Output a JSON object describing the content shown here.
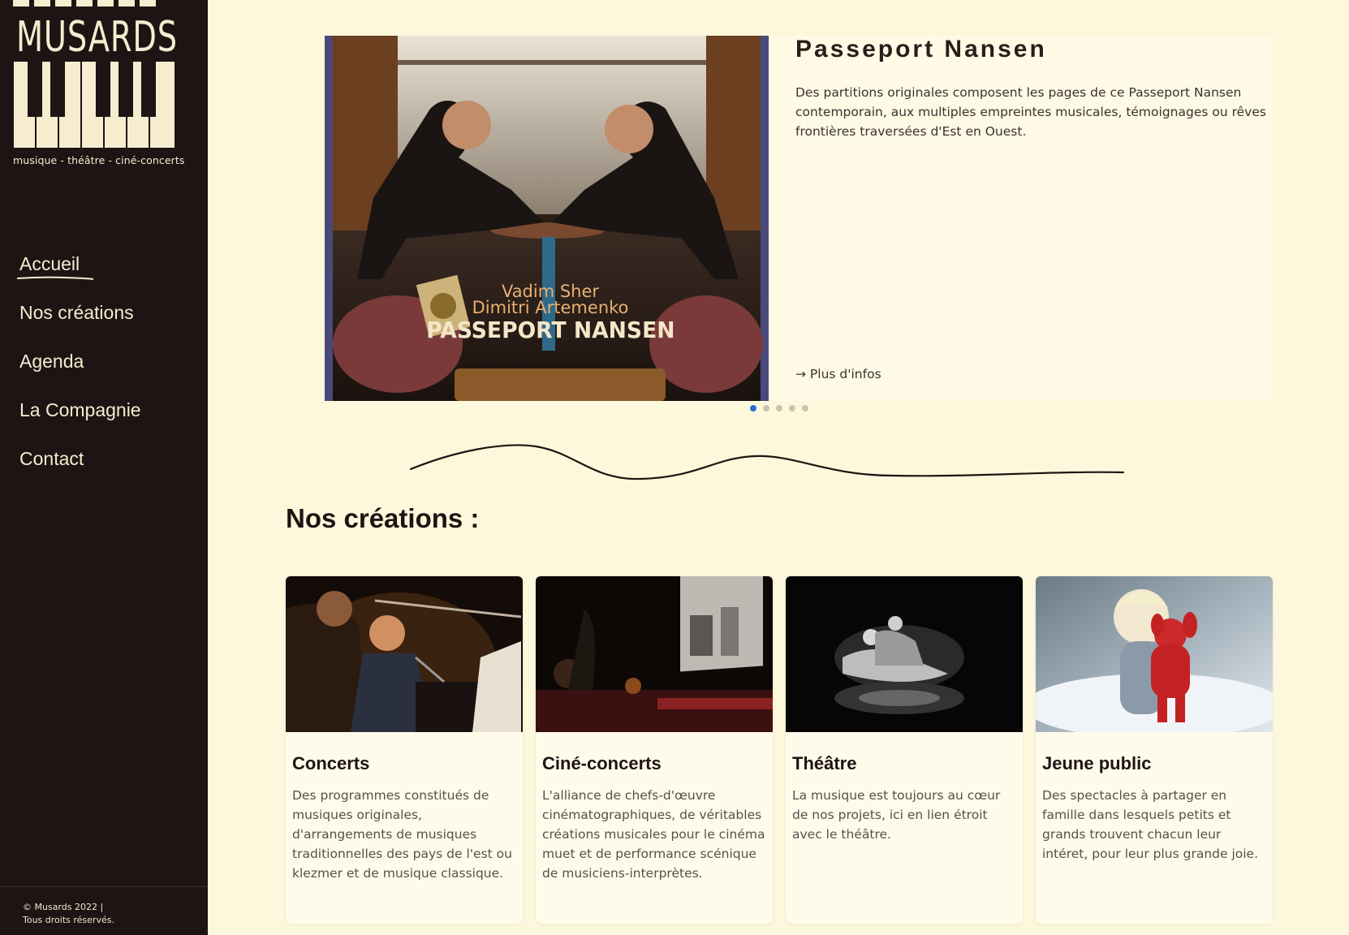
{
  "brand": {
    "name": "MUSARDS",
    "tagline": "musique - théâtre - ciné-concerts"
  },
  "nav": {
    "items": [
      {
        "label": "Accueil",
        "active": true
      },
      {
        "label": "Nos créations",
        "active": false
      },
      {
        "label": "Agenda",
        "active": false
      },
      {
        "label": "La Compagnie",
        "active": false
      },
      {
        "label": "Contact",
        "active": false
      }
    ]
  },
  "footer": {
    "copyright": "© Musards 2022 |",
    "rights": "Tous droits réservés."
  },
  "slider": {
    "title": "Passeport Nansen",
    "description": "Des partitions originales composent les pages de ce Passeport Nansen contemporain, aux multiples empreintes musicales, témoignages ou rêves frontières traversées d'Est en Ouest.",
    "more_link": "→ Plus d'infos",
    "image_text": {
      "artist1": "Vadim Sher",
      "artist2": "Dimitri Artemenko",
      "album": "PASSEPORT NANSEN"
    },
    "dots": 5,
    "active_dot": 0
  },
  "section": {
    "title": "Nos créations :"
  },
  "cards": [
    {
      "title": "Concerts",
      "description": "Des programmes constitués de musiques originales, d'arrangements de musiques traditionnelles des pays de l'est ou klezmer et de musique classique."
    },
    {
      "title": "Ciné-concerts",
      "description": "L'alliance de chefs-d'œuvre cinématographiques, de véritables créations musicales pour le cinéma muet et de performance scénique de musiciens-interprètes."
    },
    {
      "title": "Théâtre",
      "description": "La musique est toujours au cœur de nos projets, ici en lien étroit avec le théâtre."
    },
    {
      "title": "Jeune public",
      "description": "Des spectacles à partager en famille dans lesquels petits et grands trouvent chacun leur intéret, pour leur plus grande joie."
    }
  ],
  "colors": {
    "background": "#fdf8dc",
    "sidebar": "#1f1413",
    "sidebar_text": "#f6ecd0",
    "active_dot": "#2f6cd6"
  }
}
